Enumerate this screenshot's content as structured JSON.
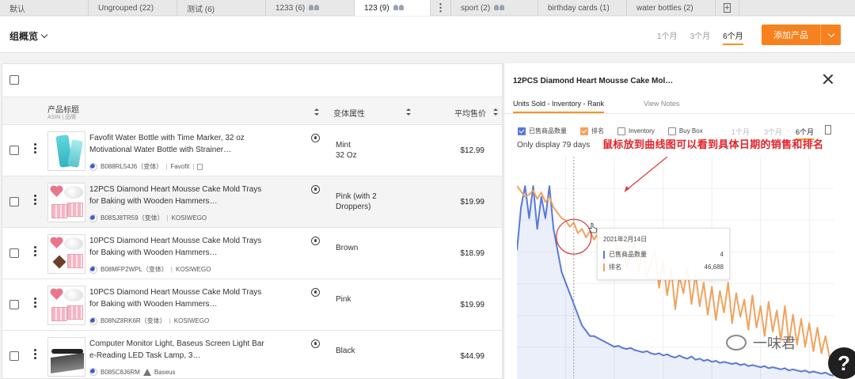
{
  "tabs": [
    {
      "label": "默认",
      "shared": false,
      "active": false
    },
    {
      "label": "Ungrouped (22)",
      "shared": false,
      "active": false
    },
    {
      "label": "测试 (6)",
      "shared": false,
      "active": false
    },
    {
      "label": "1233 (6)",
      "shared": true,
      "active": false
    },
    {
      "label": "123 (9)",
      "shared": true,
      "active": true
    },
    {
      "label": "sport (2)",
      "shared": true,
      "active": false
    },
    {
      "label": "birthday cards (1)",
      "shared": false,
      "active": false
    },
    {
      "label": "water bottles (2)",
      "shared": false,
      "active": false
    }
  ],
  "header": {
    "overview_label": "组概览",
    "ranges": [
      "1个月",
      "3个月",
      "6个月"
    ],
    "active_range": "6个月",
    "add_button": "添加产品"
  },
  "table": {
    "col_title": "产品标题",
    "col_title_sub": "ASIN | 品牌",
    "col_variant": "变体属性",
    "col_price": "平均售价",
    "rows": [
      {
        "title": "Favofit Water Bottle with Time Marker, 32 oz Motivational Water Bottle with Strainer…",
        "asin": "B088RL54J6（变体）",
        "brand": "Favofit",
        "variant": "Mint\n32 Oz",
        "price": "$12.99",
        "thumb": "bottle"
      },
      {
        "title": "12PCS Diamond Heart Mousse Cake Mold Trays for Baking with Wooden Hammers…",
        "asin": "B08SJ8TR59（变体）",
        "brand": "KOSIWEGO",
        "variant": "Pink (with 2 Droppers)",
        "price": "$19.99",
        "thumb": "mold"
      },
      {
        "title": "10PCS Diamond Heart Mousse Cake Mold Trays for Baking with Wooden Hammers…",
        "asin": "B08MFP2WPL（变体）",
        "brand": "KOSIWEGO",
        "variant": "Brown",
        "price": "$18.99",
        "thumb": "mold-brown"
      },
      {
        "title": "10PCS Diamond Heart Mousse Cake Mold Trays for Baking with Wooden Hammers…",
        "asin": "B08NZ8RK6R（变体）",
        "brand": "KOSIWEGO",
        "variant": "Pink",
        "price": "$19.99",
        "thumb": "mold"
      },
      {
        "title": "Computer Monitor Light, Baseus Screen Light Bar e-Reading LED Task Lamp, 3…",
        "asin": "B085C8J6RM",
        "brand": "Baseus",
        "variant": "Black",
        "price": "$44.99",
        "thumb": "lamp"
      }
    ]
  },
  "panel": {
    "title": "12PCS Diamond Heart Mousse Cake Mol…",
    "tab_active": "Units Sold - Inventory - Rank",
    "tab_other": "View Notes",
    "legend": [
      {
        "label": "已售商品数量",
        "checked": true,
        "color": "#5a79d6"
      },
      {
        "label": "排名",
        "checked": true,
        "color": "#f0a35d"
      },
      {
        "label": "Inventory",
        "checked": false,
        "color": ""
      },
      {
        "label": "Buy Box",
        "checked": false,
        "color": ""
      }
    ],
    "ranges": [
      "1个月",
      "3个月",
      "6个月"
    ],
    "active_range": "6个月",
    "only_display": "Only display 79 days",
    "annotation": "鼠标放到曲线图可以看到具体日期的销售和排名",
    "tooltip": {
      "date": "2021年2月14日",
      "rows": [
        {
          "label": "已售商品数量",
          "value": "4",
          "color": "#5a79d6"
        },
        {
          "label": "排名",
          "value": "46,688",
          "color": "#f0a35d"
        }
      ]
    },
    "watermark": "一味君",
    "help": "?"
  },
  "chart_data": {
    "type": "line",
    "x_points": 79,
    "series": [
      {
        "name": "已售商品数量",
        "color": "#5a79d6",
        "fill": true,
        "values": [
          12,
          16,
          18,
          15,
          18,
          14,
          17,
          15,
          18,
          14,
          12,
          10,
          9,
          8,
          7,
          6,
          5,
          4.5,
          4,
          4,
          3.8,
          3.6,
          3.4,
          3.2,
          3,
          3.1,
          2.9,
          2.8,
          2.9,
          2.7,
          2.6,
          2.5,
          2.6,
          2.4,
          2.3,
          2.4,
          2.2,
          2.3,
          2.1,
          2,
          2.2,
          2,
          1.9,
          2.1,
          1.8,
          1.9,
          1.7,
          1.8,
          1.6,
          1.7,
          1.5,
          1.6,
          1.5,
          1.4,
          1.5,
          1.3,
          1.4,
          1.2,
          1.3,
          1.2,
          1.1,
          1.2,
          1,
          1.1,
          1,
          0.9,
          1,
          0.8,
          0.9,
          0.8,
          0.7,
          0.8,
          0.6,
          0.7,
          0.6,
          0.5,
          0.6,
          0.4,
          0.3
        ]
      },
      {
        "name": "排名",
        "color": "#f0a35d",
        "fill": false,
        "values": [
          18,
          17.5,
          17,
          17.2,
          17.6,
          16.8,
          17.4,
          16.5,
          17,
          16,
          15.5,
          15,
          14.8,
          14.2,
          14.6,
          13.6,
          14,
          13.2,
          13.8,
          13,
          13.6,
          12.8,
          13.2,
          12.6,
          13,
          11.5,
          12.2,
          10.5,
          11.8,
          12.6,
          10,
          12.2,
          9.5,
          10.8,
          12,
          8.5,
          11,
          7.8,
          10.2,
          6.5,
          9.6,
          8,
          10.4,
          7,
          9.8,
          6.8,
          9,
          6,
          8.6,
          5.5,
          8.2,
          6.2,
          9,
          5.2,
          8,
          5.8,
          7.4,
          4.6,
          7.8,
          4.8,
          6.8,
          4,
          7.2,
          4.4,
          6.4,
          3.6,
          6.8,
          3.4,
          6,
          3.2,
          5.6,
          3,
          5.2,
          2.6,
          4.8,
          2.4,
          4,
          2,
          1.2
        ]
      }
    ],
    "y2_inverted": false,
    "grid": true,
    "tooltip_index": 14
  }
}
